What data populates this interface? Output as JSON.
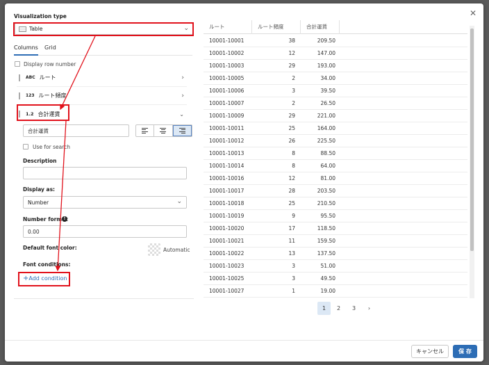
{
  "left": {
    "viz_label": "Visualization type",
    "viz_value": "Table",
    "tabs": [
      "Columns",
      "Grid"
    ],
    "display_row_number": "Display row number",
    "columns": [
      {
        "badge": "ABC",
        "name": "ルート"
      },
      {
        "badge": "123",
        "name": "ルート頻度"
      },
      {
        "badge": "1.2",
        "name": "合計運賃"
      }
    ],
    "column_title_value": "合計運賃",
    "use_for_search": "Use for search",
    "description_label": "Description",
    "display_as_label": "Display as:",
    "display_as_value": "Number",
    "number_format_label": "Number format",
    "number_format_value": "0.00",
    "default_font_color_label": "Default font color:",
    "automatic_label": "Automatic",
    "font_conditions_label": "Font conditions:",
    "add_condition_label": "Add condition"
  },
  "table": {
    "headers": [
      "ルート",
      "ルート頻度",
      "合計運賃"
    ],
    "rows": [
      [
        "10001-10001",
        "38",
        "209.50"
      ],
      [
        "10001-10002",
        "12",
        "147.00"
      ],
      [
        "10001-10003",
        "29",
        "193.00"
      ],
      [
        "10001-10005",
        "2",
        "34.00"
      ],
      [
        "10001-10006",
        "3",
        "39.50"
      ],
      [
        "10001-10007",
        "2",
        "26.50"
      ],
      [
        "10001-10009",
        "29",
        "221.00"
      ],
      [
        "10001-10011",
        "25",
        "164.00"
      ],
      [
        "10001-10012",
        "26",
        "225.50"
      ],
      [
        "10001-10013",
        "8",
        "88.50"
      ],
      [
        "10001-10014",
        "8",
        "64.00"
      ],
      [
        "10001-10016",
        "12",
        "81.00"
      ],
      [
        "10001-10017",
        "28",
        "203.50"
      ],
      [
        "10001-10018",
        "25",
        "210.50"
      ],
      [
        "10001-10019",
        "9",
        "95.50"
      ],
      [
        "10001-10020",
        "17",
        "118.50"
      ],
      [
        "10001-10021",
        "11",
        "159.50"
      ],
      [
        "10001-10022",
        "13",
        "137.50"
      ],
      [
        "10001-10023",
        "3",
        "51.00"
      ],
      [
        "10001-10025",
        "3",
        "49.50"
      ],
      [
        "10001-10027",
        "1",
        "19.00"
      ]
    ]
  },
  "pagination": {
    "pages": [
      "1",
      "2",
      "3"
    ],
    "next": "›",
    "active": "1"
  },
  "footer": {
    "cancel": "キャンセル",
    "save": "保 存"
  },
  "colors": {
    "accent": "#2d6db5",
    "highlight": "#e1111b"
  }
}
